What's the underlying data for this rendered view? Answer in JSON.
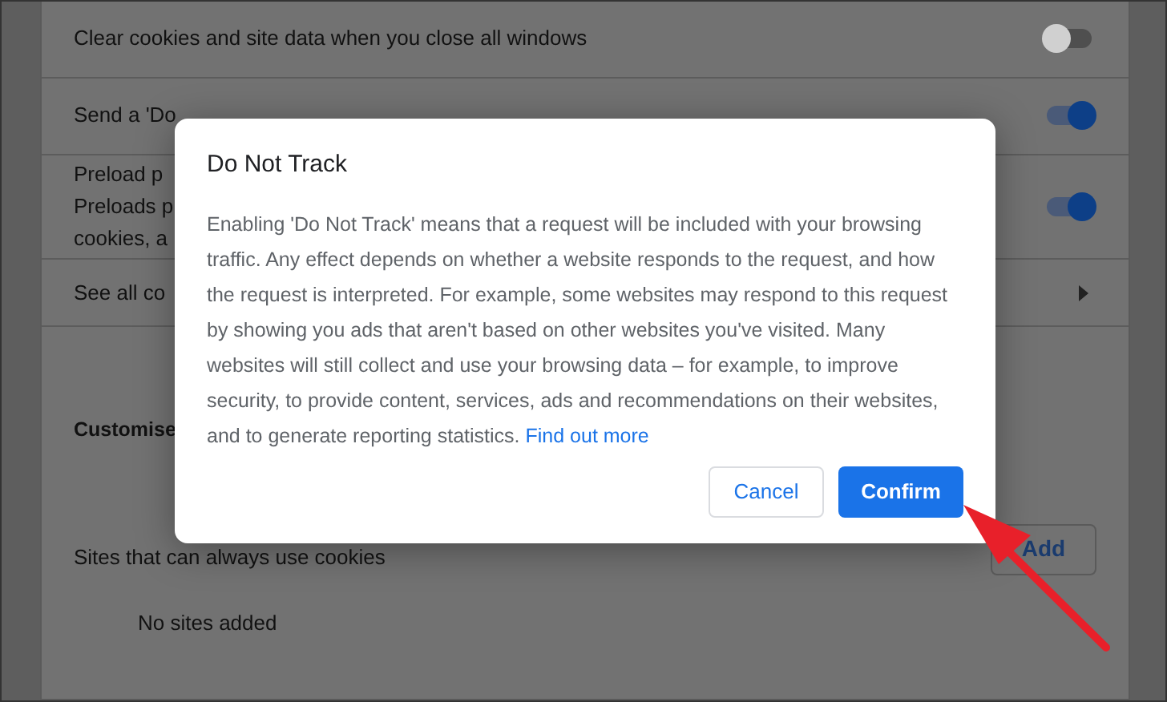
{
  "settings": {
    "rows": [
      {
        "kind": "toggle",
        "label": "Clear cookies and site data when you close all windows",
        "on": false
      },
      {
        "kind": "toggle",
        "label": "Send a 'Do",
        "on": true
      },
      {
        "kind": "toggle2",
        "label": "Preload p",
        "sublines": [
          "Preloads p",
          "cookies, a"
        ],
        "on": true
      },
      {
        "kind": "link",
        "label": "See all co"
      }
    ],
    "section_heading": "Customise",
    "sites": {
      "label": "Sites that can always use cookies",
      "button": "Add",
      "empty": "No sites added"
    }
  },
  "dialog": {
    "title": "Do Not Track",
    "body": "Enabling 'Do Not Track' means that a request will be included with your browsing traffic. Any effect depends on whether a website responds to the request, and how the request is interpreted. For example, some websites may respond to this request by showing you ads that aren't based on other websites you've visited. Many websites will still collect and use your browsing data – for example, to improve security, to provide content, services, ads and recommendations on their websites, and to generate reporting statistics.",
    "link": "Find out more",
    "buttons": [
      {
        "label": "Cancel",
        "kind": "secondary"
      },
      {
        "label": "Confirm",
        "kind": "primary"
      }
    ]
  }
}
